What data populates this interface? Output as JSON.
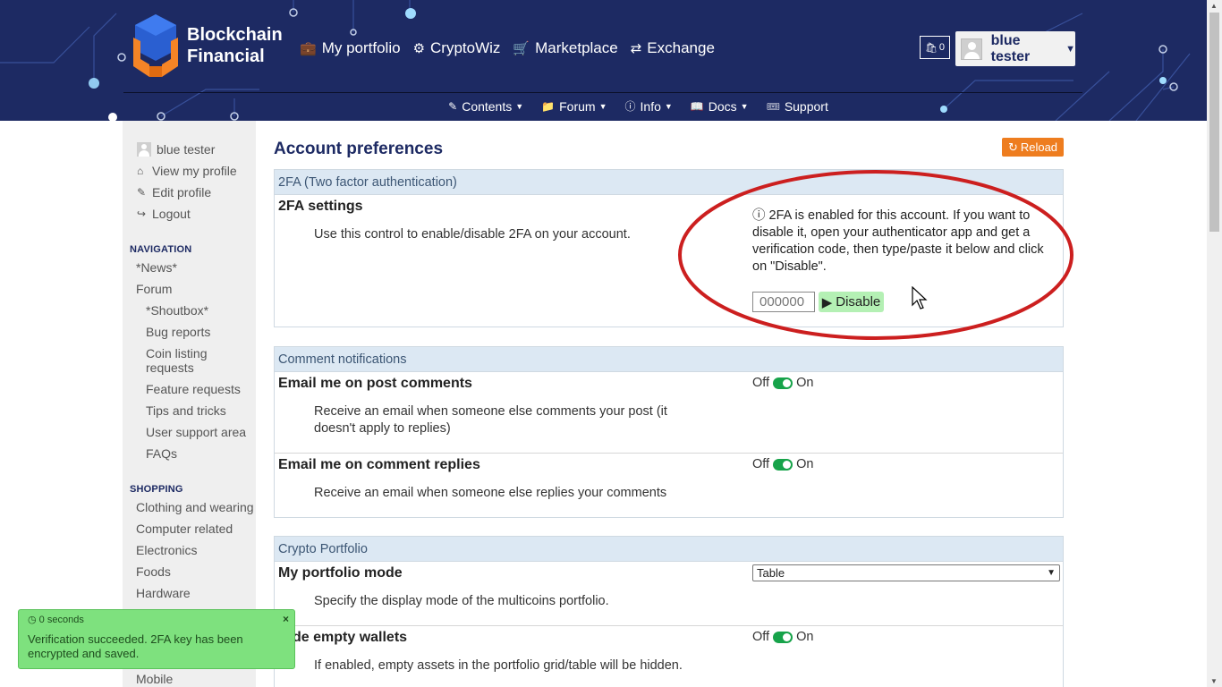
{
  "header": {
    "brand_line1": "Blockchain",
    "brand_line2": "Financial",
    "nav": [
      {
        "label": "My portfolio",
        "icon": "briefcase-icon"
      },
      {
        "label": "CryptoWiz",
        "icon": "dashboard-icon"
      },
      {
        "label": "Marketplace",
        "icon": "cart-icon"
      },
      {
        "label": "Exchange",
        "icon": "exchange-icon"
      }
    ],
    "cart_count": "0",
    "user_name": "blue tester",
    "subnav": [
      {
        "label": "Contents",
        "icon": "edit-icon"
      },
      {
        "label": "Forum",
        "icon": "folder-icon"
      },
      {
        "label": "Info",
        "icon": "info-icon"
      },
      {
        "label": "Docs",
        "icon": "book-icon"
      },
      {
        "label": "Support",
        "icon": "ticket-icon"
      }
    ]
  },
  "sidebar": {
    "user_links": [
      "blue tester",
      "View my profile",
      "Edit profile",
      "Logout"
    ],
    "navigation_heading": "NAVIGATION",
    "navigation": [
      "*News*",
      "Forum",
      "*Shoutbox*",
      "Bug reports",
      "Coin listing requests",
      "Feature requests",
      "Tips and tricks",
      "User support area",
      "FAQs"
    ],
    "shopping_heading": "SHOPPING",
    "shopping": [
      "Clothing and wearing",
      "Computer related",
      "Electronics",
      "Foods",
      "Hardware",
      "Mobile"
    ]
  },
  "main": {
    "title": "Account preferences",
    "reload_label": "Reload",
    "twofa": {
      "heading": "2FA (Two factor authentication)",
      "setting_title": "2FA settings",
      "setting_desc": "Use this control to enable/disable 2FA on your account.",
      "info": "2FA is enabled for this account. If you want to disable it, open your authenticator app and get a verification code, then type/paste it below and click on \"Disable\".",
      "code_placeholder": "000000",
      "disable_label": "Disable"
    },
    "comments": {
      "heading": "Comment notifications",
      "rows": [
        {
          "title": "Email me on post comments",
          "desc": "Receive an email when someone else comments your post (it doesn't apply to replies)",
          "off": "Off",
          "on": "On"
        },
        {
          "title": "Email me on comment replies",
          "desc": "Receive an email when someone else replies your comments",
          "off": "Off",
          "on": "On"
        }
      ]
    },
    "portfolio": {
      "heading": "Crypto Portfolio",
      "mode_title": "My portfolio mode",
      "mode_desc": "Specify the display mode of the multicoins portfolio.",
      "mode_value": "Table",
      "empty_title": "Hide empty wallets",
      "empty_desc": "If enabled, empty assets in the portfolio grid/table will be hidden.",
      "off": "Off",
      "on": "On"
    }
  },
  "toast": {
    "time": "0 seconds",
    "message": "Verification succeeded. 2FA key has been encrypted and saved.",
    "close": "×"
  },
  "colors": {
    "header_bg": "#1d2a63",
    "accent_orange": "#ee7d1f",
    "toggle_green": "#17a34a",
    "toast_green": "#7ee17e",
    "highlight_red": "#cc1f1f"
  }
}
